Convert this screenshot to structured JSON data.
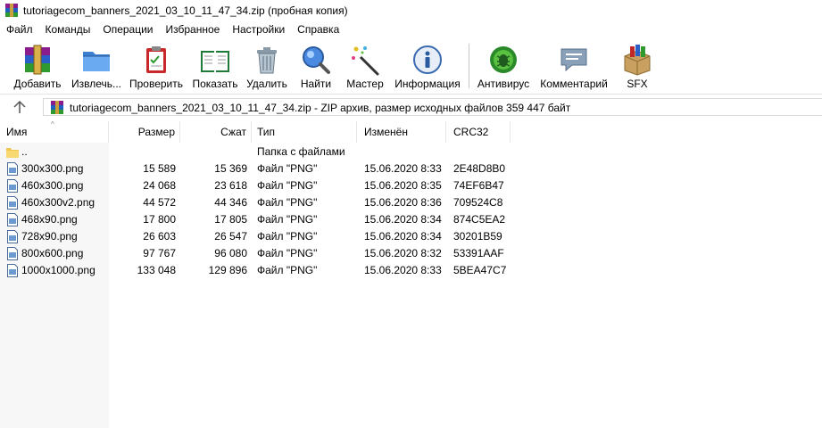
{
  "window": {
    "title": "tutoriagecom_banners_2021_03_10_11_47_34.zip (пробная копия)"
  },
  "menu": [
    "Файл",
    "Команды",
    "Операции",
    "Избранное",
    "Настройки",
    "Справка"
  ],
  "toolbar": [
    {
      "label": "Добавить",
      "icon": "add-archive-icon"
    },
    {
      "label": "Извлечь...",
      "icon": "extract-folder-icon"
    },
    {
      "label": "Проверить",
      "icon": "test-clipboard-icon"
    },
    {
      "label": "Показать",
      "icon": "view-book-icon"
    },
    {
      "label": "Удалить",
      "icon": "trash-icon"
    },
    {
      "label": "Найти",
      "icon": "find-magnifier-icon"
    },
    {
      "label": "Мастер",
      "icon": "wizard-wand-icon"
    },
    {
      "label": "Информация",
      "icon": "info-icon"
    },
    {
      "label": "Антивирус",
      "icon": "antivirus-bug-icon"
    },
    {
      "label": "Комментарий",
      "icon": "comment-icon"
    },
    {
      "label": "SFX",
      "icon": "sfx-box-icon"
    }
  ],
  "pathbar": {
    "text": "tutoriagecom_banners_2021_03_10_11_47_34.zip - ZIP архив, размер исходных файлов 359 447 байт"
  },
  "columns": {
    "name": "Имя",
    "size": "Размер",
    "packed": "Сжат",
    "type": "Тип",
    "modified": "Изменён",
    "crc": "CRC32"
  },
  "rows": [
    {
      "name": "..",
      "size": "",
      "packed": "",
      "type": "Папка с файлами",
      "modified": "",
      "crc": "",
      "icon": "folder-icon"
    },
    {
      "name": "300x300.png",
      "size": "15 589",
      "packed": "15 369",
      "type": "Файл \"PNG\"",
      "modified": "15.06.2020 8:33",
      "crc": "2E48D8B0",
      "icon": "file-icon"
    },
    {
      "name": "460x300.png",
      "size": "24 068",
      "packed": "23 618",
      "type": "Файл \"PNG\"",
      "modified": "15.06.2020 8:35",
      "crc": "74EF6B47",
      "icon": "file-icon"
    },
    {
      "name": "460x300v2.png",
      "size": "44 572",
      "packed": "44 346",
      "type": "Файл \"PNG\"",
      "modified": "15.06.2020 8:36",
      "crc": "709524C8",
      "icon": "file-icon"
    },
    {
      "name": "468x90.png",
      "size": "17 800",
      "packed": "17 805",
      "type": "Файл \"PNG\"",
      "modified": "15.06.2020 8:34",
      "crc": "874C5EA2",
      "icon": "file-icon"
    },
    {
      "name": "728x90.png",
      "size": "26 603",
      "packed": "26 547",
      "type": "Файл \"PNG\"",
      "modified": "15.06.2020 8:34",
      "crc": "30201B59",
      "icon": "file-icon"
    },
    {
      "name": "800x600.png",
      "size": "97 767",
      "packed": "96 080",
      "type": "Файл \"PNG\"",
      "modified": "15.06.2020 8:32",
      "crc": "53391AAF",
      "icon": "file-icon"
    },
    {
      "name": "1000x1000.png",
      "size": "133 048",
      "packed": "129 896",
      "type": "Файл \"PNG\"",
      "modified": "15.06.2020 8:33",
      "crc": "5BEA47C7",
      "icon": "file-icon"
    }
  ]
}
